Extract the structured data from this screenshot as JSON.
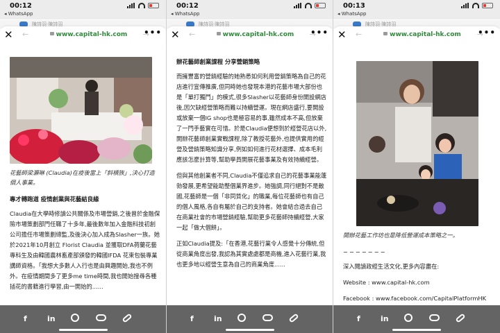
{
  "status": {
    "time_1": "00:12",
    "time_2": "00:12",
    "time_3": "00:13",
    "back_app": "◂ WhatsApp"
  },
  "peek_text": "陳詩羽·陳詩羽",
  "browser": {
    "url": "www.capital-hk.com"
  },
  "panel1": {
    "caption": "花藝師梁灝琳 (Claudia)在疫後當上「斜槓族」,決心打造個人事業。",
    "heading": "專才轉跑道 疫情創業與花藝結良緣",
    "body": "Claudia在大學時修讀公共關係及市場營銷,之後曾於金融保險市場策劃部門任職了十多年,最後數年加入金融科技初創公司擔任市場策劃總監,及後決心加入成為Slasher一族。她於2021年10月創立 Florist Claudia 並獲取DFA荷蘭花藝專科生及由韓國農林畜產部頒發的韓國IFDA 花束包裝專業講師資格。「我想大多數人入行也是由興趣開始,我也不例外。在疫情期間多了更多me time時間,我也開始搜尋各種插花的書籍進行學習,由一開始的......"
  },
  "panel2": {
    "heading": "辦花藝師創業課程 分享營銷策略",
    "p1": "而擁豐富的營銷經驗的她熟悉如何利用營銷策略為自己的花店進行宣傳推廣,但同時她也發現本港的花藝市場大部份也是「單打獨鬥」的模式,很多Slasher以花藝師身份開設網店後,因欠缺經營策略而難以持續營運。現在網店盛行,要開設或放棄一個IG shop也是極容易的事,雖然成本不高,但放棄了一門手藝實在可惜。於是Claudia便想到於經營花店以外,開辦花藝師創業實戰課程,除了教授花藝外,也提供實用的經營及營銷策略知識分享,例如如何進行花材選擇、成本毛利應該怎麼計算等,幫助學員開展花藝事業及有效持續經營。",
    "p2": "但與其他創業者不同,Claudia不僅追求自己的花藝事業能蓬勃發展,更希望能助整個業界進步。她強調,同行絕對不是敵國,花藝師是一個「非同質化」的職業,每位花藝師也有自己的個人風格,各自有屬於自己的支持者。她會結合過去自己在商業社會的市場營銷經驗,幫助更多花藝師持續經營,大家一起「做大個餅」。",
    "p3": "正如Claudia提及:「在香港,花藝行業令人感覺十分傳統,但從商業角度出發,我認為其實處處都是商機,進入花藝行業,我也更多地以經營生意為自己的商業角度......"
  },
  "panel3": {
    "caption": "開辦花藝工作坊也是降低營運成本策略之一。",
    "dashes": "−−−−−−−",
    "more_text": "深入閱讀政經生活文化,更多內容盡在:",
    "website": "Website : www.capital-hk.com",
    "facebook": "Facebook : www.facebook.com/CapitalPlatformHK"
  },
  "share": {
    "facebook": "f",
    "linkedin": "in"
  },
  "colors": {
    "url_green": "#2e8b3a",
    "sharebar": "#282828",
    "battery_red": "#e53935"
  }
}
